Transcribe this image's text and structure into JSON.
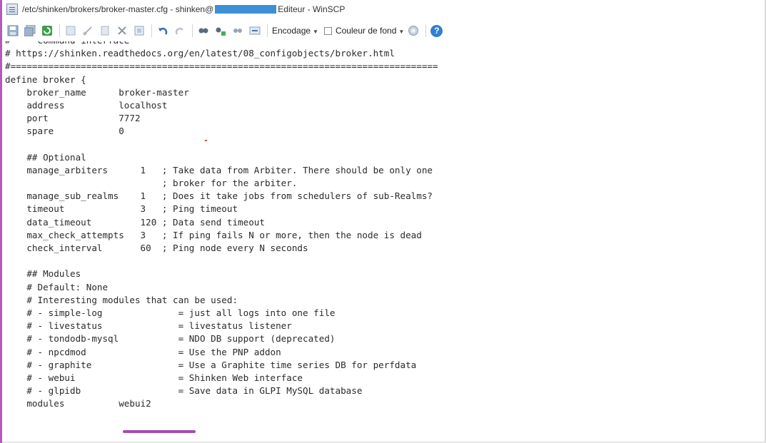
{
  "window": {
    "title_prefix": "/etc/shinken/brokers/broker-master.cfg - shinken@",
    "title_suffix": "Editeur - WinSCP"
  },
  "toolbar": {
    "encoding_label": "Encodage",
    "background_color_label": "Couleur de fond",
    "icons": [
      "save-icon",
      "save-all-icon",
      "reload-icon",
      "cut-icon",
      "copy-icon",
      "paste-icon",
      "delete-icon",
      "select-all-icon",
      "undo-icon",
      "redo-icon",
      "find-icon",
      "replace-icon",
      "find-next-icon",
      "goto-line-icon",
      "color-swatch-icon",
      "help-icon"
    ]
  },
  "editor": {
    "lines": [
      "#   - Command interface",
      "# https://shinken.readthedocs.org/en/latest/08_configobjects/broker.html",
      "#===============================================================================",
      "define broker {",
      "    broker_name      broker-master",
      "    address          localhost",
      "    port             7772",
      "    spare            0",
      "",
      "    ## Optional",
      "    manage_arbiters      1   ; Take data from Arbiter. There should be only one",
      "                             ; broker for the arbiter.",
      "    manage_sub_realms    1   ; Does it take jobs from schedulers of sub-Realms?",
      "    timeout              3   ; Ping timeout",
      "    data_timeout         120 ; Data send timeout",
      "    max_check_attempts   3   ; If ping fails N or more, then the node is dead",
      "    check_interval       60  ; Ping node every N seconds",
      "",
      "    ## Modules",
      "    # Default: None",
      "    # Interesting modules that can be used:",
      "    # - simple-log              = just all logs into one file",
      "    # - livestatus              = livestatus listener",
      "    # - tondodb-mysql           = NDO DB support (deprecated)",
      "    # - npcdmod                 = Use the PNP addon",
      "    # - graphite                = Use a Graphite time series DB for perfdata",
      "    # - webui                   = Shinken Web interface",
      "    # - glpidb                  = Save data in GLPI MySQL database",
      "    modules          webui2"
    ]
  },
  "colors": {
    "accent_underline": "#a64ab2",
    "redaction": "#3d8fd6",
    "help_button": "#2f7fd3"
  }
}
